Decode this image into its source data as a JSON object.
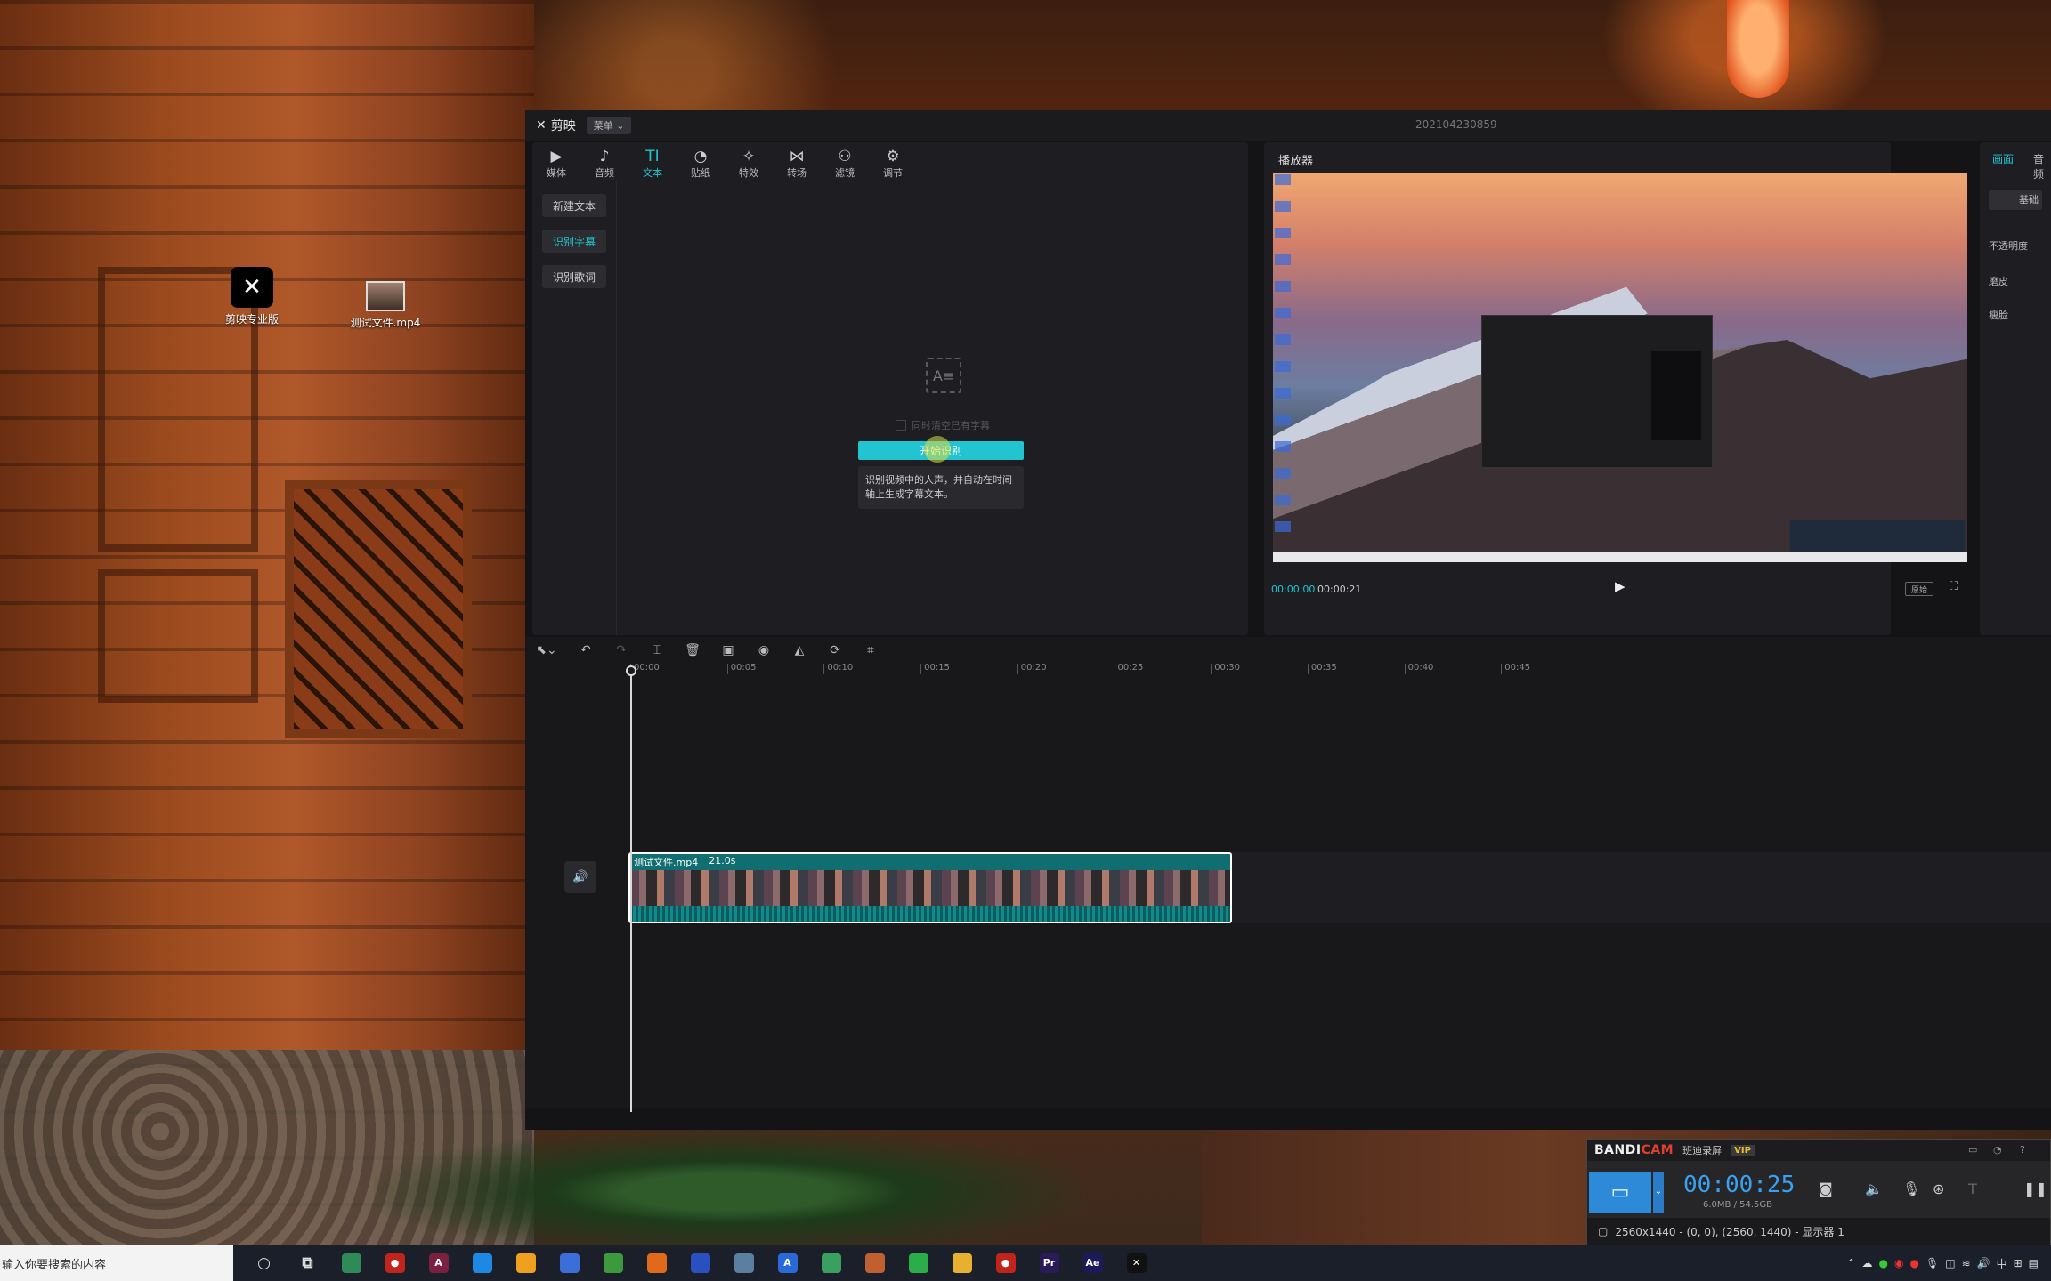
{
  "desktop": {
    "icons": [
      {
        "label": "剪映专业版",
        "icon": "capcut-logo-icon"
      },
      {
        "label": "测试文件.mp4",
        "icon": "video-file-icon"
      }
    ]
  },
  "app": {
    "name": "剪映",
    "menu_label": "菜单",
    "window_title": "202104230859",
    "toolbar": [
      {
        "label": "媒体",
        "icon": "media-icon",
        "glyph": "▶"
      },
      {
        "label": "音频",
        "icon": "audio-icon",
        "glyph": "♪"
      },
      {
        "label": "文本",
        "icon": "text-icon",
        "glyph": "TI"
      },
      {
        "label": "贴纸",
        "icon": "sticker-icon",
        "glyph": "◔"
      },
      {
        "label": "特效",
        "icon": "effects-icon",
        "glyph": "✧"
      },
      {
        "label": "转场",
        "icon": "transition-icon",
        "glyph": "⋈"
      },
      {
        "label": "滤镜",
        "icon": "filter-icon",
        "glyph": "⚇"
      },
      {
        "label": "调节",
        "icon": "adjust-icon",
        "glyph": "⚙"
      }
    ],
    "active_tool": "文本",
    "sidebar": [
      "新建文本",
      "识别字幕",
      "识别歌词"
    ],
    "active_side": "识别字幕",
    "recognize": {
      "checkbox_label": "同时清空已有字幕",
      "button_label": "开始识别",
      "tip": "识别视频中的人声，并自动在时间轴上生成字幕文本。"
    },
    "player": {
      "title": "播放器",
      "current_time": "00:00:00",
      "total_time": "00:00:21",
      "ratio_label": "原始"
    },
    "properties": {
      "tabs": [
        "画面",
        "音频"
      ],
      "basic_label": "基础",
      "opacity_label": "不透明度",
      "smooth_label": "磨皮",
      "thin_face_label": "瘦脸"
    },
    "timeline": {
      "ticks": [
        "00:00",
        "00:05",
        "00:10",
        "00:15",
        "00:20",
        "00:25",
        "00:30",
        "00:35",
        "00:40",
        "00:45"
      ],
      "clip_name": "测试文件.mp4",
      "clip_duration": "21.0s"
    }
  },
  "bandicam": {
    "brand_a": "BANDI",
    "brand_b": "CAM",
    "name": "班迪录屏",
    "vip": "VIP",
    "timer": "00:00:25",
    "size": "6.0MB / 54.5GB",
    "status": "2560x1440 - (0, 0), (2560, 1440) - 显示器 1"
  },
  "taskbar": {
    "search_placeholder": "输入你要搜索的内容",
    "apps": [
      {
        "name": "cortana-icon",
        "glyph": "○",
        "color": "transparent"
      },
      {
        "name": "task-view-icon",
        "glyph": "⧉",
        "color": "transparent"
      },
      {
        "name": "app-green-icon",
        "glyph": "",
        "color": "#2e8b57"
      },
      {
        "name": "record-red-icon",
        "glyph": "●",
        "color": "#c0241c"
      },
      {
        "name": "app-pink-icon",
        "glyph": "A",
        "color": "#7a2040"
      },
      {
        "name": "app-blue-icon",
        "glyph": "",
        "color": "#1e88e5"
      },
      {
        "name": "app-yellow-icon",
        "glyph": "",
        "color": "#f0a020"
      },
      {
        "name": "app-grid-icon",
        "glyph": "",
        "color": "#3b6ed8"
      },
      {
        "name": "app-panda-icon",
        "glyph": "",
        "color": "#3c9a3c"
      },
      {
        "name": "app-orange-icon",
        "glyph": "",
        "color": "#e06a1a"
      },
      {
        "name": "app-sheet-icon",
        "glyph": "",
        "color": "#2a4fc0"
      },
      {
        "name": "app-tool-icon",
        "glyph": "",
        "color": "#5a7fa0"
      },
      {
        "name": "app-a-icon",
        "glyph": "A",
        "color": "#2a6ad8"
      },
      {
        "name": "app-globe-icon",
        "glyph": "",
        "color": "#3aa060"
      },
      {
        "name": "app-paint-icon",
        "glyph": "",
        "color": "#c06030"
      },
      {
        "name": "wechat-icon",
        "glyph": "",
        "color": "#2aae4a"
      },
      {
        "name": "folder-icon",
        "glyph": "",
        "color": "#e8b030"
      },
      {
        "name": "record2-icon",
        "glyph": "●",
        "color": "#c0241c"
      },
      {
        "name": "premiere-icon",
        "glyph": "Pr",
        "color": "#2a1a5a"
      },
      {
        "name": "after-effects-icon",
        "glyph": "Ae",
        "color": "#1a1a5a"
      },
      {
        "name": "capcut-taskbar-icon",
        "glyph": "✕",
        "color": "#111"
      }
    ],
    "ime": "中"
  }
}
